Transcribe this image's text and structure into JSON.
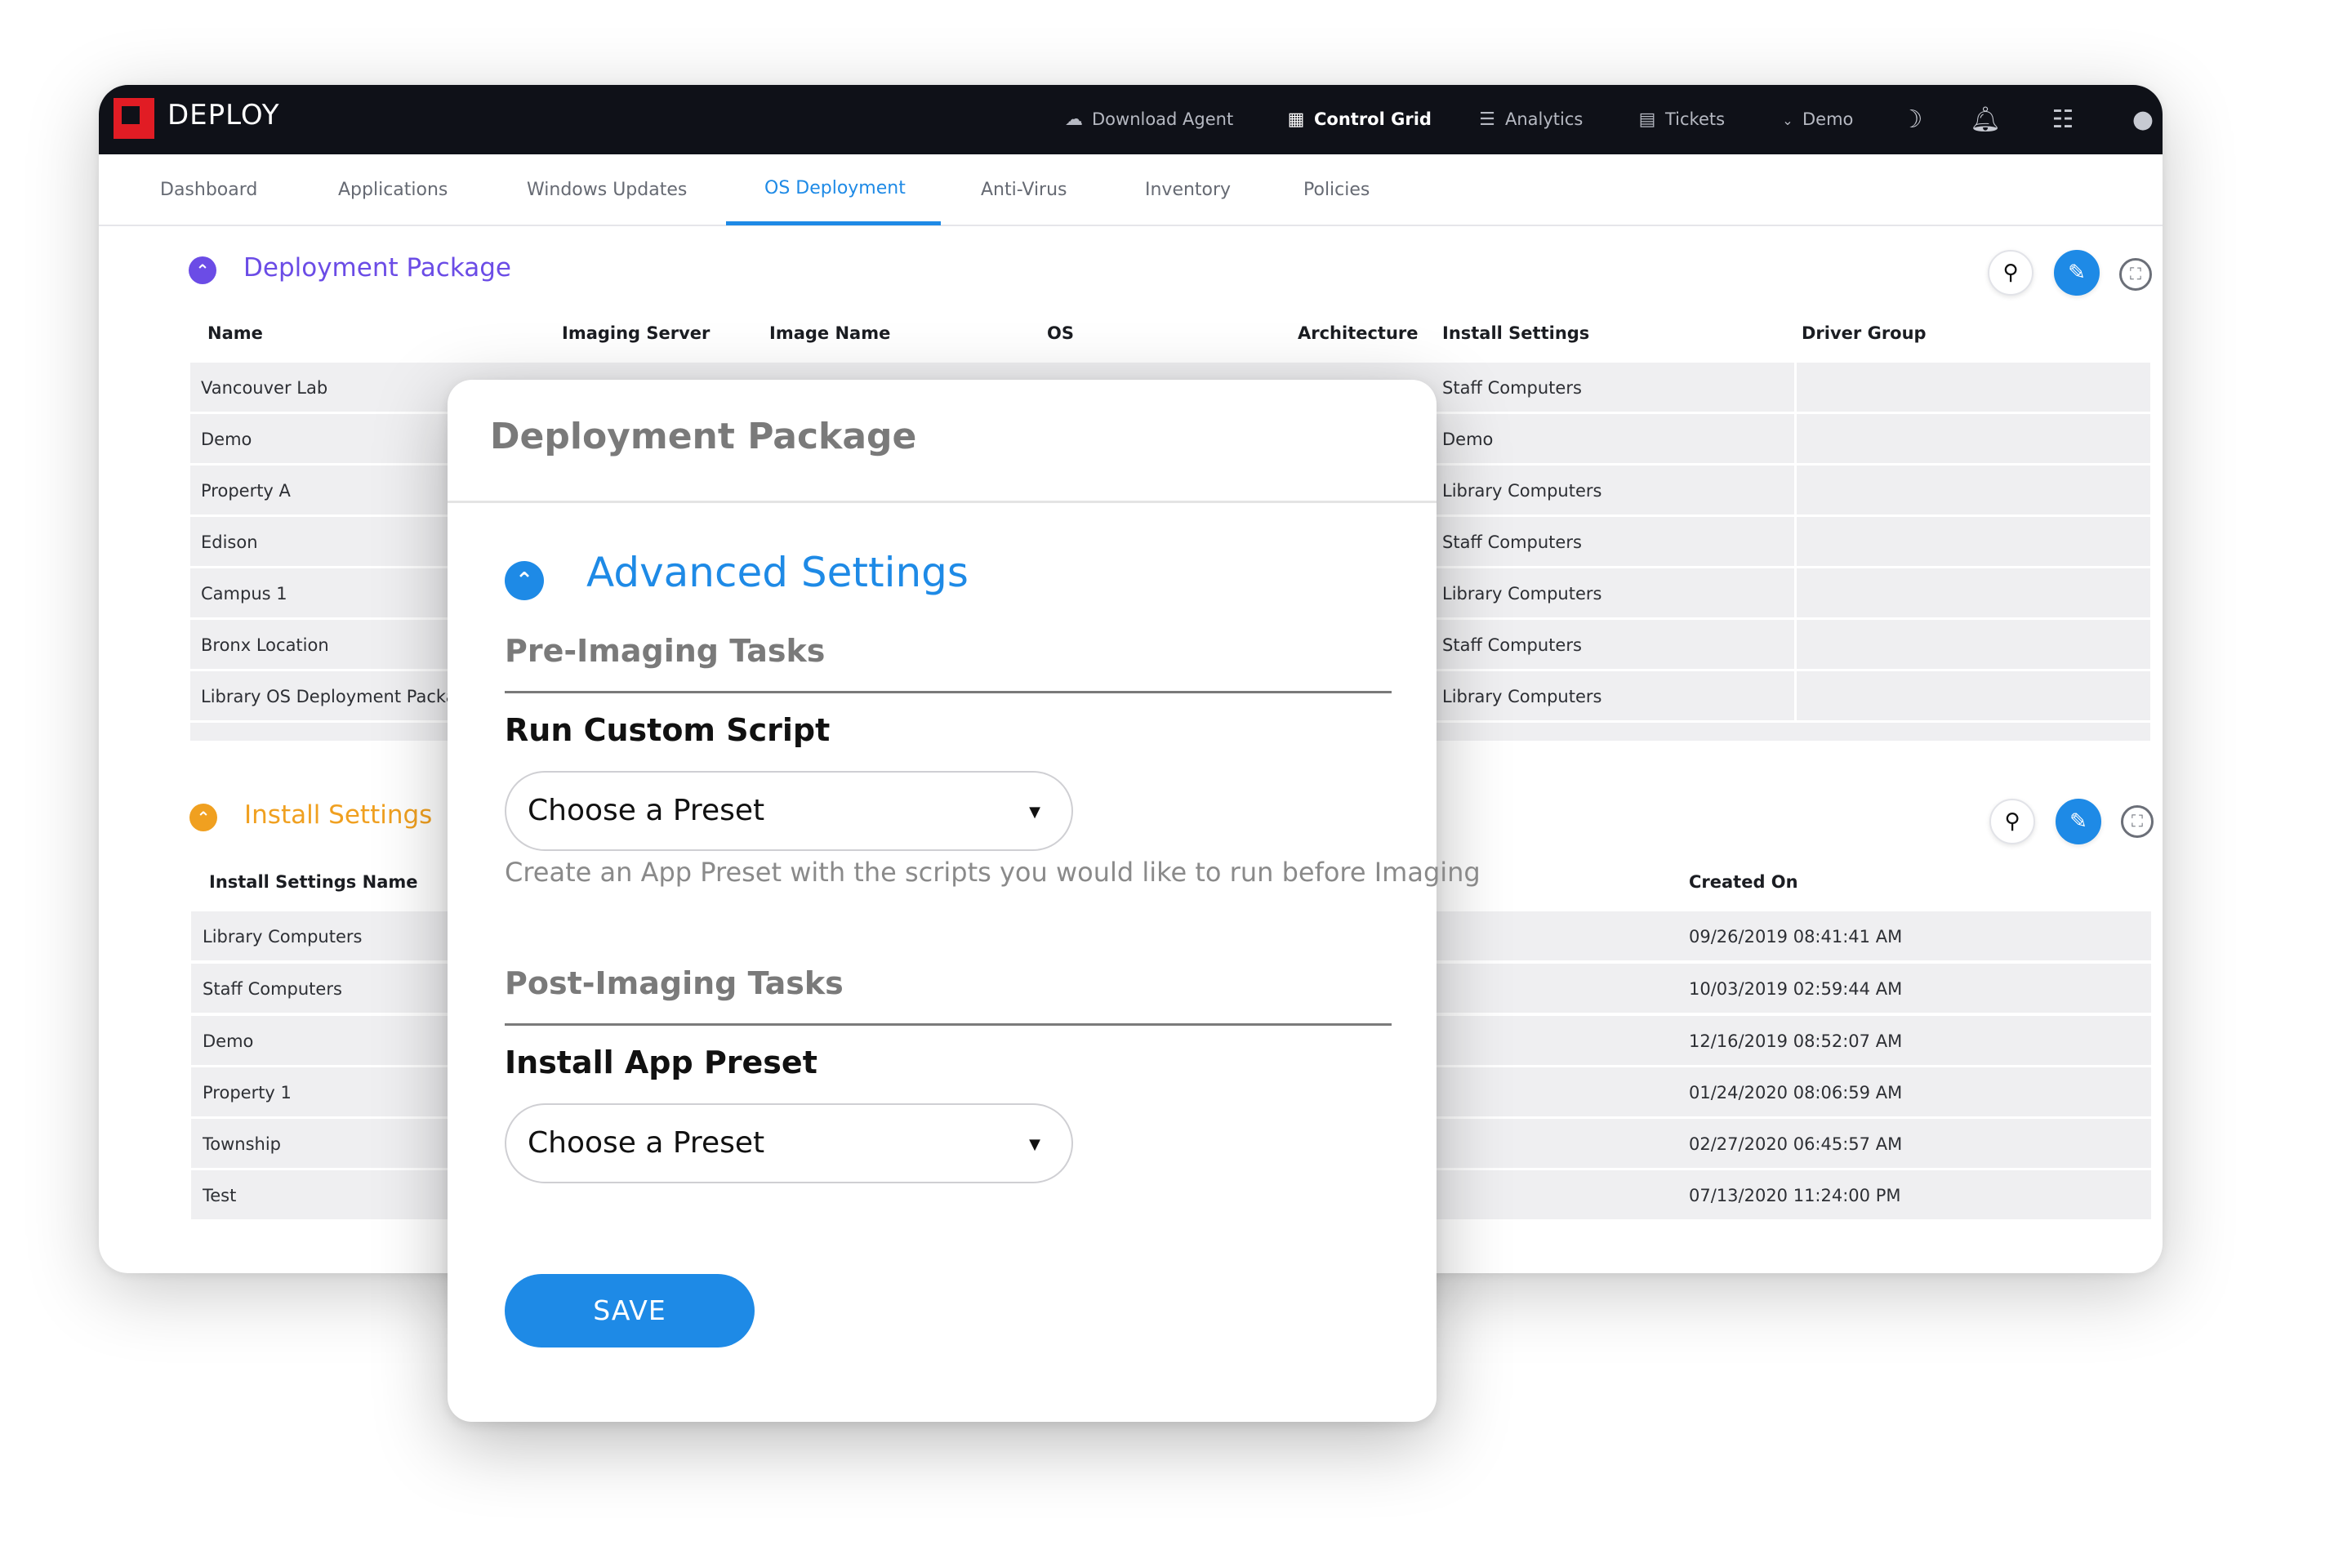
{
  "app": {
    "brand": "DEPLOY",
    "brand_color": "#e11c24",
    "nav": {
      "download_agent": "Download Agent",
      "control_grid": "Control Grid",
      "analytics": "Analytics",
      "tickets": "Tickets",
      "demo": "Demo",
      "icons": [
        "cloud-download-icon",
        "grid-icon",
        "list-icon",
        "ticket-icon",
        "chevron-down-icon",
        "moon-icon",
        "bell-icon",
        "checklist-icon",
        "user-icon"
      ]
    },
    "tabs": [
      "Dashboard",
      "Applications",
      "Windows Updates",
      "OS Deployment",
      "Anti-Virus",
      "Inventory",
      "Policies"
    ],
    "active_tab": "OS Deployment",
    "accent_color": "#1e8ae6"
  },
  "deployment_package": {
    "title": "Deployment Package",
    "title_color": "#6b4ce6",
    "columns": [
      "Name",
      "Imaging Server",
      "Image Name",
      "OS",
      "Architecture",
      "Install Settings",
      "Driver Group"
    ],
    "rows": [
      {
        "name": "Vancouver Lab",
        "install_settings": "Staff Computers"
      },
      {
        "name": "Demo",
        "install_settings": "Demo"
      },
      {
        "name": "Property A",
        "install_settings": "Library Computers"
      },
      {
        "name": "Edison",
        "install_settings": "Staff Computers"
      },
      {
        "name": "Campus 1",
        "install_settings": "Library Computers"
      },
      {
        "name": "Bronx Location",
        "install_settings": "Staff Computers"
      },
      {
        "name": "Library OS Deployment Packag",
        "install_settings": "Library Computers"
      }
    ]
  },
  "install_settings": {
    "title": "Install Settings",
    "title_color": "#f0a020",
    "columns": [
      "Install Settings Name",
      "Created On"
    ],
    "rows": [
      {
        "name": "Library Computers",
        "created_on": "09/26/2019 08:41:41 AM"
      },
      {
        "name": "Staff Computers",
        "created_on": "10/03/2019 02:59:44 AM"
      },
      {
        "name": "Demo",
        "created_on": "12/16/2019 08:52:07 AM"
      },
      {
        "name": "Property 1",
        "created_on": "01/24/2020 08:06:59 AM"
      },
      {
        "name": "Township",
        "created_on": "02/27/2020 06:45:57 AM"
      },
      {
        "name": "Test",
        "created_on": "07/13/2020 11:24:00 PM"
      }
    ]
  },
  "modal": {
    "title": "Deployment Package",
    "advanced_title": "Advanced Settings",
    "pre_imaging_heading": "Pre-Imaging Tasks",
    "run_custom_script_label": "Run Custom Script",
    "run_custom_script_value": "Choose a Preset",
    "pre_helper": "Create an App Preset with the scripts you would like to run before Imaging",
    "post_imaging_heading": "Post-Imaging Tasks",
    "install_app_preset_label": "Install App Preset",
    "install_app_preset_value": "Choose a Preset",
    "save_label": "SAVE"
  }
}
